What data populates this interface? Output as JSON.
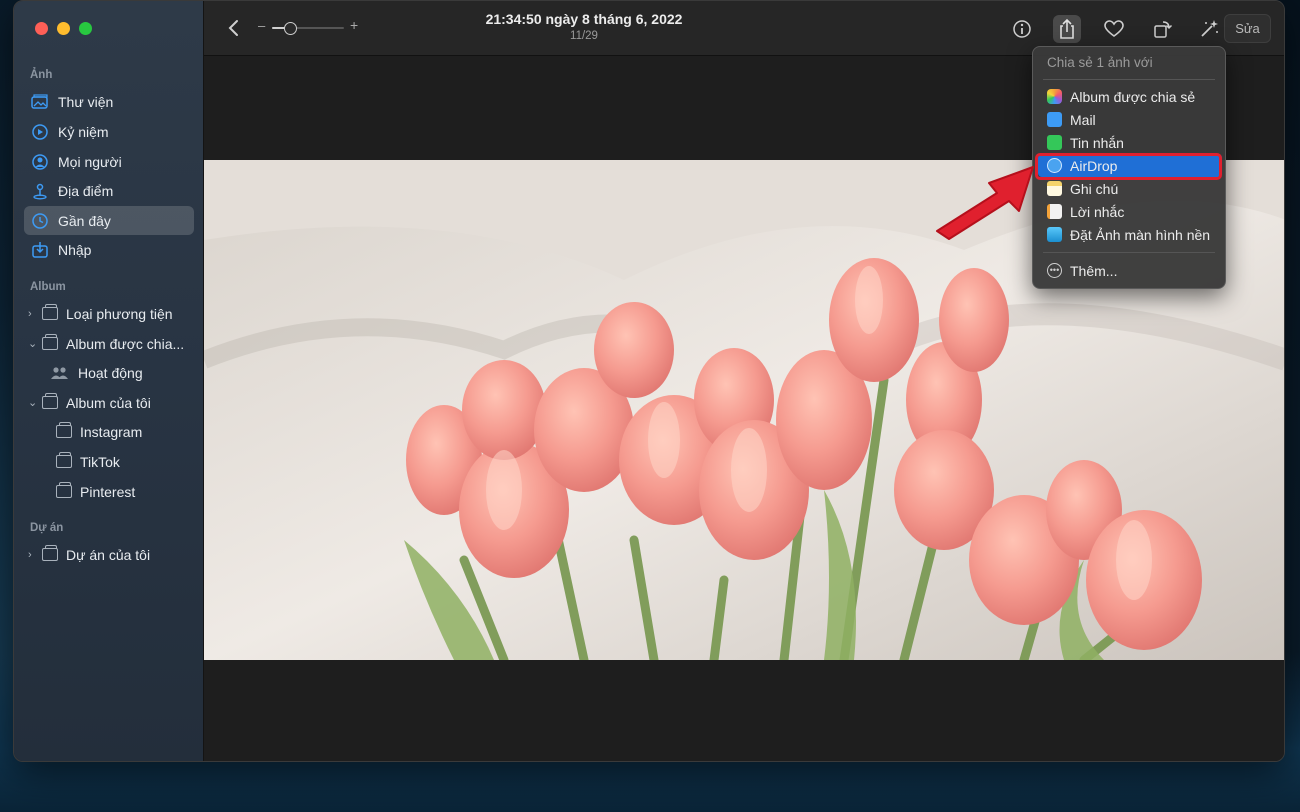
{
  "window": {
    "title": "21:34:50 ngày 8 tháng 6, 2022",
    "subtitle": "11/29"
  },
  "sidebar": {
    "sections": [
      {
        "label": "Ảnh"
      },
      {
        "label": "Album"
      },
      {
        "label": "Dự án"
      }
    ],
    "photos_items": [
      {
        "label": "Thư viện",
        "icon": "library-icon"
      },
      {
        "label": "Kỷ niệm",
        "icon": "memories-icon"
      },
      {
        "label": "Mọi người",
        "icon": "people-icon"
      },
      {
        "label": "Địa điểm",
        "icon": "places-icon"
      },
      {
        "label": "Gần đây",
        "icon": "recents-icon",
        "selected": true
      },
      {
        "label": "Nhập",
        "icon": "import-icon"
      }
    ],
    "album_items": [
      {
        "label": "Loại phương tiện",
        "expanded": false
      },
      {
        "label": "Album được chia...",
        "expanded": true
      },
      {
        "label": "Hoạt động"
      },
      {
        "label": "Album của tôi",
        "expanded": true
      },
      {
        "label": "Instagram"
      },
      {
        "label": "TikTok"
      },
      {
        "label": "Pinterest"
      }
    ],
    "project_items": [
      {
        "label": "Dự án của tôi",
        "expanded": false
      }
    ]
  },
  "toolbar": {
    "zoom_minus": "–",
    "zoom_plus": "+",
    "zoom_level": 0.25,
    "edit_label": "Sửa",
    "icons": [
      "info-icon",
      "share-icon",
      "favorite-heart-icon",
      "rotate-icon",
      "auto-enhance-icon"
    ]
  },
  "share_menu": {
    "header": "Chia sẻ 1 ảnh với",
    "items": [
      {
        "label": "Album được chia sẻ",
        "icon": "shared-album-icon",
        "color": "#f2a33a"
      },
      {
        "label": "Mail",
        "icon": "mail-icon",
        "color": "#3d9bf5"
      },
      {
        "label": "Tin nhắn",
        "icon": "messages-icon",
        "color": "#34c759"
      },
      {
        "label": "AirDrop",
        "icon": "airdrop-icon",
        "color": "#4aa3f0",
        "highlighted": true
      },
      {
        "label": "Ghi chú",
        "icon": "notes-icon",
        "color": "#f5d36b"
      },
      {
        "label": "Lời nhắc",
        "icon": "reminders-icon",
        "color": "#f2f2f2"
      },
      {
        "label": "Đặt Ảnh màn hình nền",
        "icon": "wallpaper-icon",
        "color": "#5ac8fa"
      }
    ],
    "more_label": "Thêm..."
  },
  "colors": {
    "accent": "#1f6fd6",
    "annotation": "#e0202e"
  }
}
